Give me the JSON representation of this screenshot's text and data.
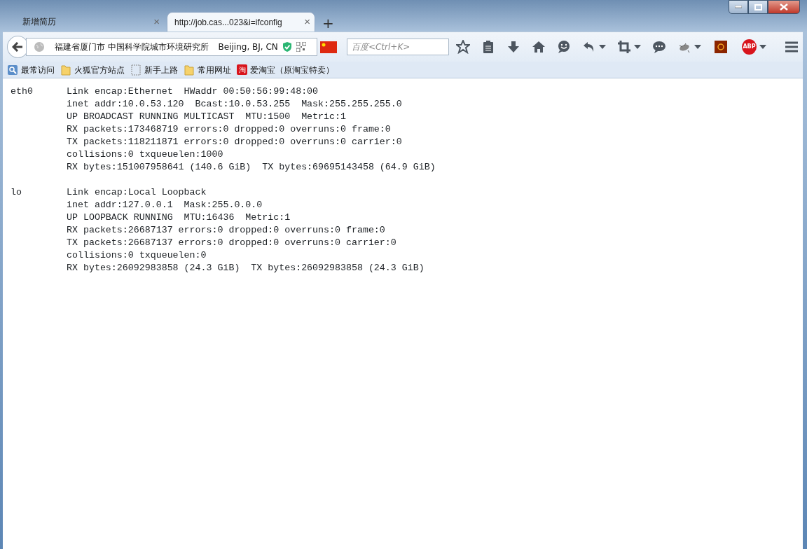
{
  "tabs": [
    {
      "label": "新增简历",
      "selected": false,
      "close": "×"
    },
    {
      "label": "http://job.cas...023&i=ifconfig",
      "selected": true,
      "close": "×"
    }
  ],
  "new_tab": "+",
  "address_bar": {
    "location": "福建省厦门市 中国科学院城市环境研究所",
    "geo": "Beijing, BJ, CN"
  },
  "search": {
    "placeholder": "百度<Ctrl+K>"
  },
  "toolbar": {
    "abp_label": "ABP"
  },
  "bookmarks": [
    {
      "label": "最常访问",
      "kind": "history"
    },
    {
      "label": "火狐官方站点",
      "kind": "folder"
    },
    {
      "label": "新手上路",
      "kind": "page"
    },
    {
      "label": "常用网址",
      "kind": "folder"
    },
    {
      "label": "爱淘宝（原淘宝特卖）",
      "kind": "shop",
      "glyph": "淘"
    }
  ],
  "interfaces": [
    {
      "name": "eth0",
      "lines": [
        "Link encap:Ethernet  HWaddr 00:50:56:99:48:00",
        "inet addr:10.0.53.120  Bcast:10.0.53.255  Mask:255.255.255.0",
        "UP BROADCAST RUNNING MULTICAST  MTU:1500  Metric:1",
        "RX packets:173468719 errors:0 dropped:0 overruns:0 frame:0",
        "TX packets:118211871 errors:0 dropped:0 overruns:0 carrier:0",
        "collisions:0 txqueuelen:1000",
        "RX bytes:151007958641 (140.6 GiB)  TX bytes:69695143458 (64.9 GiB)"
      ]
    },
    {
      "name": "lo",
      "lines": [
        "Link encap:Local Loopback",
        "inet addr:127.0.0.1  Mask:255.0.0.0",
        "UP LOOPBACK RUNNING  MTU:16436  Metric:1",
        "RX packets:26687137 errors:0 dropped:0 overruns:0 frame:0",
        "TX packets:26687137 errors:0 dropped:0 overruns:0 carrier:0",
        "collisions:0 txqueuelen:0",
        "RX bytes:26092983858 (24.3 GiB)  TX bytes:26092983858 (24.3 GiB)"
      ]
    }
  ]
}
